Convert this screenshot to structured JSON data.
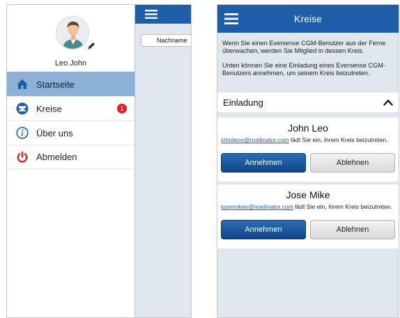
{
  "left": {
    "profile": {
      "name": "Leo John"
    },
    "menu": [
      {
        "label": "Startseite",
        "icon": "home-icon",
        "active": true
      },
      {
        "label": "Kreise",
        "icon": "group-icon",
        "badge": "1"
      },
      {
        "label": "Über uns",
        "icon": "info-icon"
      },
      {
        "label": "Abmelden",
        "icon": "power-icon"
      }
    ],
    "behind": {
      "field_text": "Nachname"
    }
  },
  "right": {
    "title": "Kreise",
    "info_1": "Wenn Sie einen Eversense CGM-Benutzer aus der Ferne überwachen, werden Sie Mitglied in dessen Kreis.",
    "info_2": "Unten können Sie eine Einladung eines Eversense CGM-Benutzers annehmen, um seinem Kreis beizutreten.",
    "section_title": "Einladung",
    "invites": [
      {
        "name": "John Leo",
        "email": "johnleoo@mailinator.com",
        "text": " lädt Sie ein, ihrem Kreis beizutreten.",
        "accept": "Annehmen",
        "decline": "Ablehnen"
      },
      {
        "name": "Jose Mike",
        "email": "josemikee@mailinator.com",
        "text": " lädt Sie ein, ihrem Kreis beizutreten.",
        "accept": "Annehmen",
        "decline": "Ablehnen"
      }
    ]
  },
  "colors": {
    "brand_blue": "#1e5ea8",
    "active_menu": "#8cb1d9",
    "badge_red": "#e41e26",
    "power_red": "#e0211b"
  }
}
